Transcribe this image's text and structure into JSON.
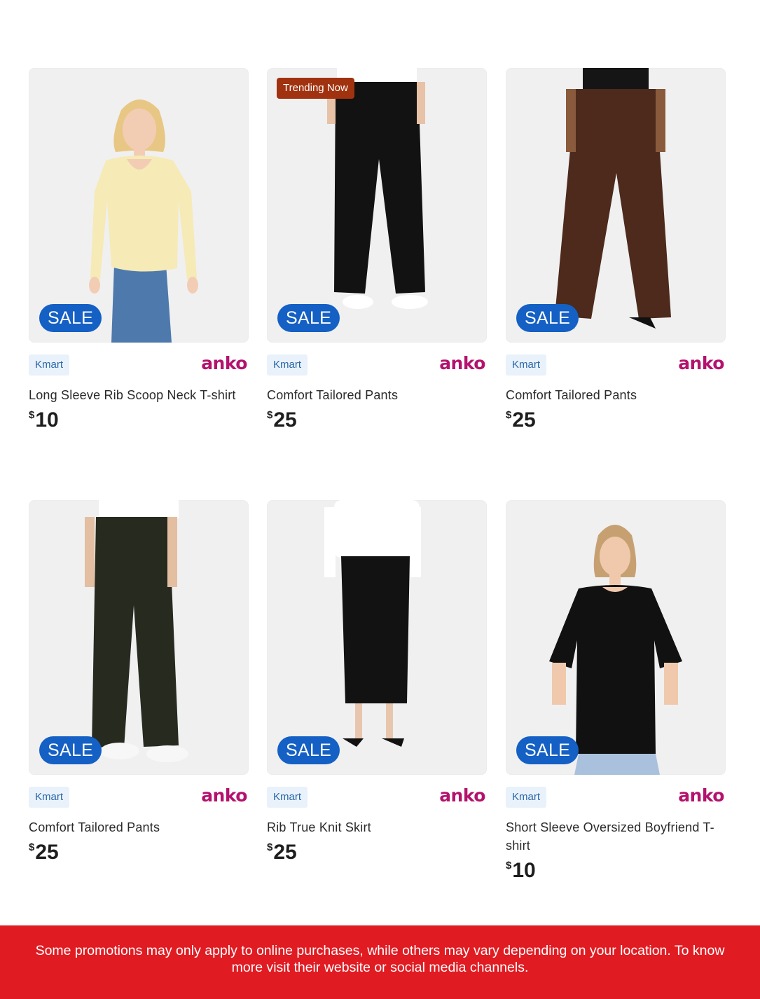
{
  "products": [
    {
      "title": "Long Sleeve Rib Scoop Neck T-shirt",
      "currency": "$",
      "price": "10",
      "store": "Kmart",
      "brand": "anko",
      "sale_label": "SALE",
      "badge": ""
    },
    {
      "title": "Comfort Tailored Pants",
      "currency": "$",
      "price": "25",
      "store": "Kmart",
      "brand": "anko",
      "sale_label": "SALE",
      "badge": "Trending Now"
    },
    {
      "title": "Comfort Tailored Pants",
      "currency": "$",
      "price": "25",
      "store": "Kmart",
      "brand": "anko",
      "sale_label": "SALE",
      "badge": ""
    },
    {
      "title": "Comfort Tailored Pants",
      "currency": "$",
      "price": "25",
      "store": "Kmart",
      "brand": "anko",
      "sale_label": "SALE",
      "badge": ""
    },
    {
      "title": "Rib True Knit Skirt",
      "currency": "$",
      "price": "25",
      "store": "Kmart",
      "brand": "anko",
      "sale_label": "SALE",
      "badge": ""
    },
    {
      "title": "Short Sleeve Oversized Boyfriend T-shirt",
      "currency": "$",
      "price": "10",
      "store": "Kmart",
      "brand": "anko",
      "sale_label": "SALE",
      "badge": ""
    }
  ],
  "footer": {
    "notice": "Some promotions may only apply to online purchases, while others may vary depending on your location. To know more visit their website or social media channels."
  },
  "colors": {
    "sale_badge": "#1460c4",
    "trending_badge": "#a1320f",
    "brand_anko": "#b4126d",
    "footer_bg": "#e11b22"
  }
}
